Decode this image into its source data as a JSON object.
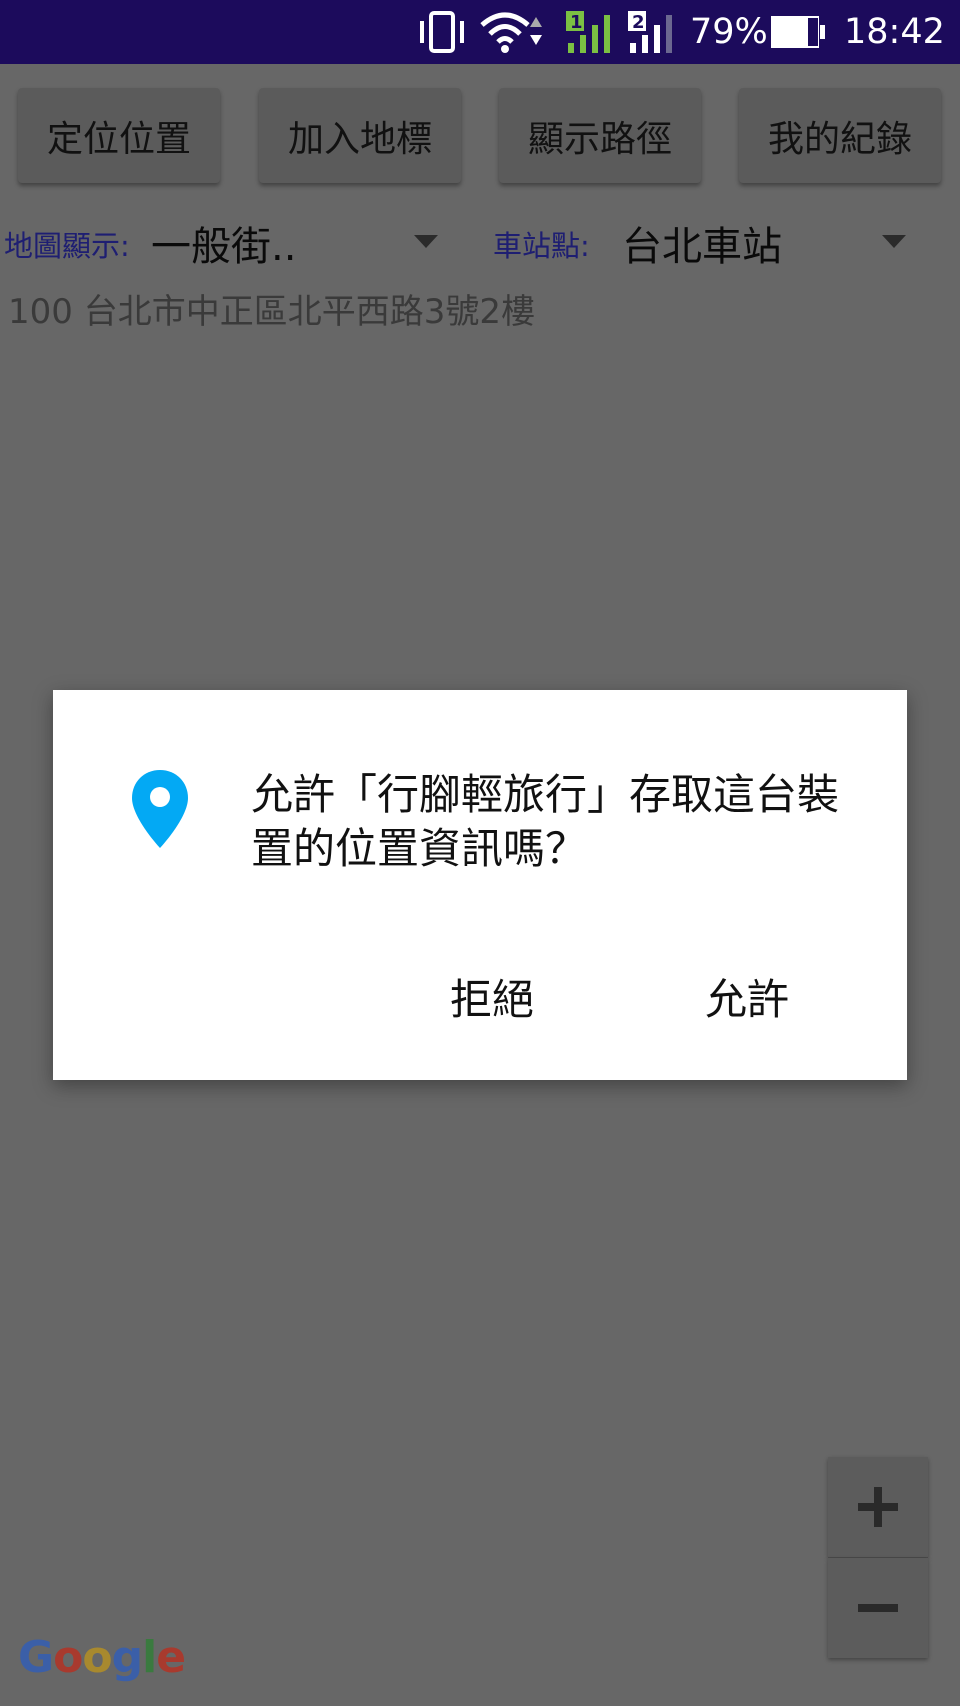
{
  "status_bar": {
    "battery_percent": "79%",
    "time": "18:42",
    "sim1_label": "1",
    "sim2_label": "2"
  },
  "toolbar": {
    "locate_label": "定位位置",
    "add_landmark_label": "加入地標",
    "show_route_label": "顯示路徑",
    "my_records_label": "我的紀錄"
  },
  "map_display": {
    "label": "地圖顯示:",
    "value": "一般街.."
  },
  "station": {
    "label": "車站點:",
    "value": "台北車站"
  },
  "address": "100 台北市中正區北平西路3號2樓",
  "dialog": {
    "message": "允許「行腳輕旅行」存取這台裝置的位置資訊嗎？",
    "deny_label": "拒絕",
    "allow_label": "允許",
    "icon": "location-pin-icon",
    "icon_color": "#03a9f4"
  },
  "zoom": {
    "in_icon": "plus-icon",
    "out_icon": "minus-icon"
  },
  "map_attribution": "Google"
}
